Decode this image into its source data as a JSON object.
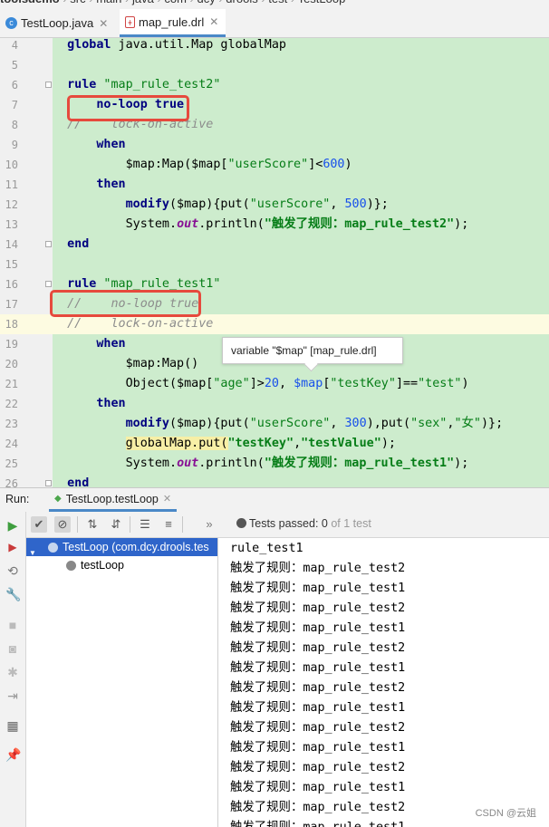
{
  "breadcrumb": [
    "toolsdemo",
    "src",
    "main",
    "java",
    "com",
    "dcy",
    "drools",
    "test",
    "TestLoop"
  ],
  "editor_tabs": [
    {
      "label": "TestLoop.java",
      "active": false
    },
    {
      "label": "map_rule.drl",
      "active": true
    }
  ],
  "code_lines": [
    {
      "n": "4",
      "segments": [
        {
          "t": "global",
          "c": "kw"
        },
        {
          "t": " java.util.Map globalMap",
          "c": ""
        }
      ]
    },
    {
      "n": "5",
      "segments": []
    },
    {
      "n": "6",
      "segments": [
        {
          "t": "rule",
          "c": "kw"
        },
        {
          "t": " \"map_rule_test2\"",
          "c": "strn"
        }
      ]
    },
    {
      "n": "7",
      "segments": [
        {
          "t": "    no-loop true",
          "c": "kw"
        }
      ]
    },
    {
      "n": "8",
      "segments": [
        {
          "t": "//    lock-on-active",
          "c": "cmt"
        }
      ]
    },
    {
      "n": "9",
      "segments": [
        {
          "t": "    when",
          "c": "kw"
        }
      ]
    },
    {
      "n": "10",
      "segments": [
        {
          "t": "        $map:Map($map[",
          "c": ""
        },
        {
          "t": "\"userScore\"",
          "c": "strn"
        },
        {
          "t": "]<",
          "c": ""
        },
        {
          "t": "600",
          "c": "num"
        },
        {
          "t": ")",
          "c": ""
        }
      ]
    },
    {
      "n": "11",
      "segments": [
        {
          "t": "    then",
          "c": "kw"
        }
      ]
    },
    {
      "n": "12",
      "segments": [
        {
          "t": "        ",
          "c": ""
        },
        {
          "t": "modify",
          "c": "fn"
        },
        {
          "t": "($map){put(",
          "c": ""
        },
        {
          "t": "\"userScore\"",
          "c": "strn"
        },
        {
          "t": ", ",
          "c": ""
        },
        {
          "t": "500",
          "c": "num"
        },
        {
          "t": ")};",
          "c": ""
        }
      ]
    },
    {
      "n": "13",
      "segments": [
        {
          "t": "        System.",
          "c": ""
        },
        {
          "t": "out",
          "c": "fld"
        },
        {
          "t": ".println(",
          "c": ""
        },
        {
          "t": "\"触发了规则：map_rule_test2\"",
          "c": "str"
        },
        {
          "t": ");",
          "c": ""
        }
      ]
    },
    {
      "n": "14",
      "segments": [
        {
          "t": "end",
          "c": "kw"
        }
      ]
    },
    {
      "n": "15",
      "segments": []
    },
    {
      "n": "16",
      "segments": [
        {
          "t": "rule",
          "c": "kw"
        },
        {
          "t": " \"map_rule_test1\"",
          "c": "strn"
        }
      ]
    },
    {
      "n": "17",
      "segments": [
        {
          "t": "//    no-loop true",
          "c": "cmt"
        }
      ]
    },
    {
      "n": "18",
      "segments": [
        {
          "t": "//    lock-on-active",
          "c": "cmt"
        }
      ]
    },
    {
      "n": "19",
      "segments": [
        {
          "t": "    when",
          "c": "kw"
        }
      ]
    },
    {
      "n": "20",
      "segments": [
        {
          "t": "        $map:Map()",
          "c": ""
        }
      ]
    },
    {
      "n": "21",
      "segments": [
        {
          "t": "        Object($map[",
          "c": ""
        },
        {
          "t": "\"age\"",
          "c": "strn"
        },
        {
          "t": "]>",
          "c": ""
        },
        {
          "t": "20",
          "c": "num"
        },
        {
          "t": ", ",
          "c": ""
        },
        {
          "t": "$map",
          "c": "var"
        },
        {
          "t": "[",
          "c": ""
        },
        {
          "t": "\"testKey\"",
          "c": "strn"
        },
        {
          "t": "]==",
          "c": ""
        },
        {
          "t": "\"test\"",
          "c": "strn"
        },
        {
          "t": ")",
          "c": ""
        }
      ]
    },
    {
      "n": "22",
      "segments": [
        {
          "t": "    then",
          "c": "kw"
        }
      ]
    },
    {
      "n": "23",
      "segments": [
        {
          "t": "        ",
          "c": ""
        },
        {
          "t": "modify",
          "c": "fn"
        },
        {
          "t": "($map){put(",
          "c": ""
        },
        {
          "t": "\"userScore\"",
          "c": "strn"
        },
        {
          "t": ", ",
          "c": ""
        },
        {
          "t": "300",
          "c": "num"
        },
        {
          "t": "),put(",
          "c": ""
        },
        {
          "t": "\"sex\"",
          "c": "strn"
        },
        {
          "t": ",",
          "c": ""
        },
        {
          "t": "\"女\"",
          "c": "strn"
        },
        {
          "t": ")};",
          "c": ""
        }
      ]
    },
    {
      "n": "24",
      "segments": [
        {
          "t": "        ",
          "c": ""
        },
        {
          "t": "globalMap.put(",
          "c": "hl"
        },
        {
          "t": "\"testKey\"",
          "c": "str"
        },
        {
          "t": ",",
          "c": ""
        },
        {
          "t": "\"testValue\"",
          "c": "str"
        },
        {
          "t": ");",
          "c": ""
        }
      ]
    },
    {
      "n": "25",
      "segments": [
        {
          "t": "        System.",
          "c": ""
        },
        {
          "t": "out",
          "c": "fld"
        },
        {
          "t": ".println(",
          "c": ""
        },
        {
          "t": "\"触发了规则：map_rule_test1\"",
          "c": "str"
        },
        {
          "t": ");",
          "c": ""
        }
      ]
    },
    {
      "n": "26",
      "segments": [
        {
          "t": "end",
          "c": "kw"
        }
      ]
    }
  ],
  "current_line": "18",
  "tooltip_text": "variable \"$map\" [map_rule.drl]",
  "run_panel": {
    "label": "Run:",
    "tab_label": "TestLoop.testLoop",
    "status_prefix": "Tests passed: ",
    "passed": "0",
    "status_suffix": " of 1 test",
    "tree": [
      {
        "label": "TestLoop (com.dcy.drools.tes",
        "selected": true,
        "indent": 0
      },
      {
        "label": "testLoop",
        "selected": false,
        "indent": 1
      }
    ]
  },
  "console_lines": [
    "rule_test1",
    "触发了规则：map_rule_test2",
    "触发了规则：map_rule_test1",
    "触发了规则：map_rule_test2",
    "触发了规则：map_rule_test1",
    "触发了规则：map_rule_test2",
    "触发了规则：map_rule_test1",
    "触发了规则：map_rule_test2",
    "触发了规则：map_rule_test1",
    "触发了规则：map_rule_test2",
    "触发了规则：map_rule_test1",
    "触发了规则：map_rule_test2",
    "触发了规则：map_rule_test1",
    "触发了规则：map_rule_test2",
    "触发了规则：map_rule_test1"
  ],
  "watermark": "CSDN @云姐",
  "colors": {
    "accent": "#4a88c7",
    "selection": "#2f65ca",
    "highlight_box": "#e64a3d",
    "code_bg": "#cdeccd"
  },
  "icons": {
    "java_file": "java-file-icon",
    "drl_file": "drl-file-icon",
    "run": "run-icon",
    "rerun_failed": "rerun-failed-icon",
    "toggle_auto": "toggle-auto-test-icon",
    "settings": "wrench-icon",
    "stop": "stop-icon",
    "camera": "camera-icon",
    "debug": "bug-icon",
    "exit": "exit-icon",
    "layout": "layout-icon",
    "pin": "pin-icon"
  }
}
